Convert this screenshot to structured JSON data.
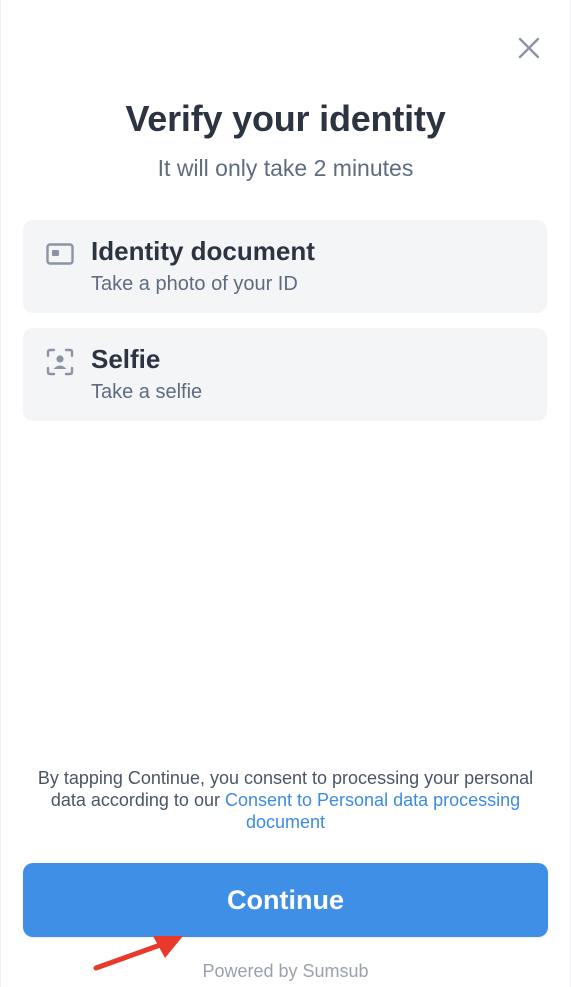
{
  "header": {
    "close_icon": "close-icon",
    "title": "Verify your identity",
    "subtitle": "It will only take 2 minutes"
  },
  "steps": [
    {
      "icon": "id-card-icon",
      "title": "Identity document",
      "subtitle": "Take a photo of your ID"
    },
    {
      "icon": "face-scan-icon",
      "title": "Selfie",
      "subtitle": "Take a selfie"
    }
  ],
  "consent": {
    "text": "By tapping Continue, you consent to processing your personal data according to our ",
    "link_text": "Consent to Personal data processing document"
  },
  "actions": {
    "continue_label": "Continue"
  },
  "footer": {
    "powered_by": "Powered by Sumsub"
  },
  "colors": {
    "primary": "#3f8fe6",
    "link": "#3c8be2",
    "card_bg": "#f4f5f7",
    "title_text": "#2c3442",
    "muted_text": "#5f6b80",
    "annotation_arrow": "#e8392b"
  }
}
